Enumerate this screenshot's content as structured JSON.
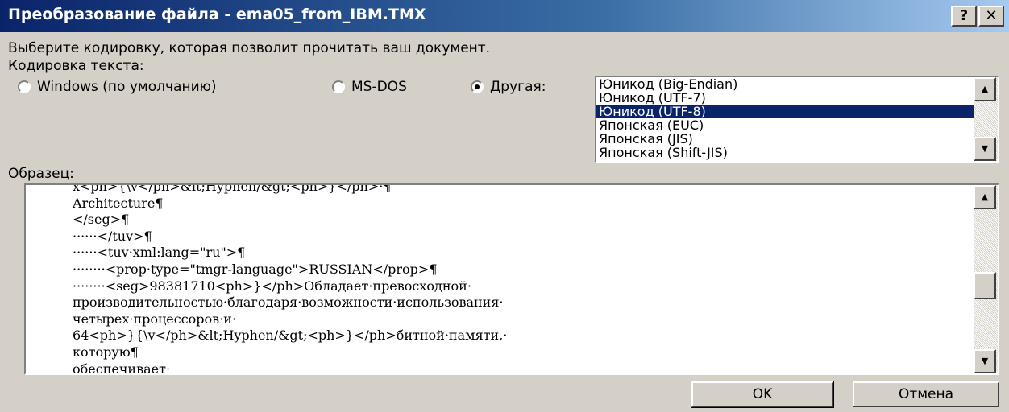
{
  "window": {
    "title": "Преобразование файла - ema05_from_IBM.TMX",
    "help_glyph": "?",
    "close_glyph": "✕"
  },
  "instruction": "Выберите кодировку, которая позволит прочитать ваш документ.",
  "encoding_label": "Кодировка текста:",
  "radios": [
    {
      "label": "Windows (по умолчанию)",
      "checked": false
    },
    {
      "label": "MS-DOS",
      "checked": false
    },
    {
      "label": "Другая:",
      "checked": true
    }
  ],
  "encoding_list": {
    "items": [
      "Юникод (Big-Endian)",
      "Юникод (UTF-7)",
      "Юникод (UTF-8)",
      "Японская (EUC)",
      "Японская (JIS)",
      "Японская (Shift-JIS)"
    ],
    "selected": "Юникод (UTF-8)"
  },
  "sample_label": "Образец:",
  "sample_lines": [
    "x<ph>{\\v</ph>&lt;Hyphen/&gt;<ph>}</ph>·¶",
    "Architecture¶",
    "</seg>¶",
    "······</tuv>¶",
    "······<tuv·xml:lang=\"ru\">¶",
    "········<prop·type=\"tmgr-language\">RUSSIAN</prop>¶",
    "········<seg>98381710<ph>}</ph>Обладает·превосходной·",
    "производительностью·благодаря·возможности·использования·",
    "четырех·процессоров·и·",
    "64<ph>}{\\v</ph>&lt;Hyphen/&gt;<ph>}</ph>битной·памяти,·",
    "которую¶",
    "обеспечивает·"
  ],
  "buttons": {
    "ok": "OK",
    "cancel": "Отмена"
  },
  "scroll_glyphs": {
    "up": "▲",
    "down": "▼"
  },
  "colors": {
    "title_start": "#0a246a",
    "title_end": "#a6caf0",
    "selection": "#0a246a",
    "face": "#d4d0c8"
  }
}
